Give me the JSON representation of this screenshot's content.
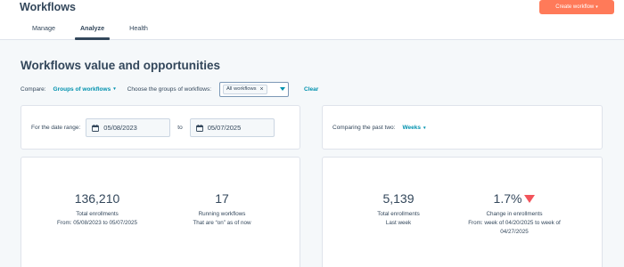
{
  "header": {
    "title": "Workflows",
    "create_button": "Create workflow"
  },
  "tabs": [
    {
      "label": "Manage",
      "active": false
    },
    {
      "label": "Analyze",
      "active": true
    },
    {
      "label": "Health",
      "active": false
    }
  ],
  "page": {
    "heading": "Workflows value and opportunities"
  },
  "filters": {
    "compare_label": "Compare:",
    "compare_value": "Groups of workflows",
    "choose_label": "Choose the groups of workflows:",
    "chip": "All workflows",
    "clear": "Clear"
  },
  "date_range": {
    "label": "For the date range:",
    "start": "05/08/2023",
    "to": "to",
    "end": "05/07/2025"
  },
  "comparison": {
    "label": "Comparing the past two:",
    "period": "Weeks"
  },
  "stats_range": {
    "total": {
      "value": "136,210",
      "label": "Total enrollments",
      "sub": "From: 05/08/2023 to 05/07/2025"
    },
    "running": {
      "value": "17",
      "label": "Running workflows",
      "sub": "That are “on” as of now"
    }
  },
  "stats_period": {
    "total": {
      "value": "5,139",
      "label": "Total enrollments",
      "sub": "Last week"
    },
    "change": {
      "value": "1.7%",
      "label": "Change in enrollments",
      "sub": "From: week of 04/20/2025 to week of 04/27/2025",
      "direction": "down"
    }
  },
  "colors": {
    "accent": "#ff7a59",
    "link": "#0091ae",
    "decrease": "#f2545b",
    "text": "#33475b"
  }
}
